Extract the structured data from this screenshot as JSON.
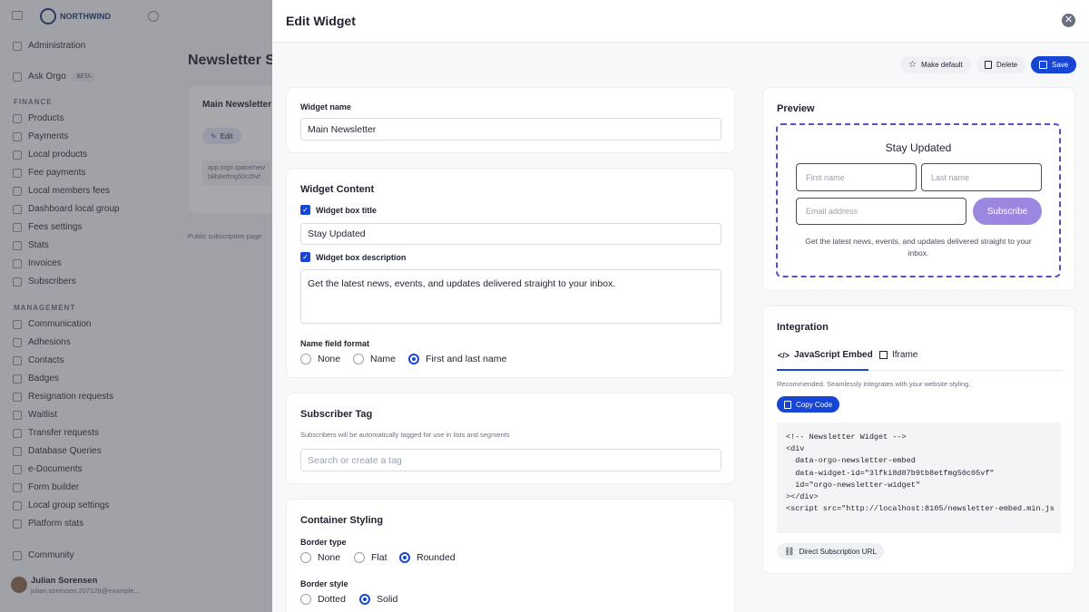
{
  "sidebar": {
    "brand": "NORTHWIND",
    "top_items": [
      "Administration",
      "Ask Orgo"
    ],
    "beta": "BETA",
    "finance_header": "FINANCE",
    "finance_items": [
      "Products",
      "Payments",
      "Local products",
      "Fee payments",
      "Local members fees",
      "Dashboard local group",
      "Fees settings",
      "Stats",
      "Invoices",
      "Subscribers"
    ],
    "management_header": "MANAGEMENT",
    "management_items": [
      "Communication",
      "Adhesions",
      "Contacts",
      "Badges",
      "Resignation requests",
      "Waitlist",
      "Transfer requests",
      "Database Queries",
      "e-Documents",
      "Form builder",
      "Local group settings",
      "Platform stats"
    ],
    "community": "Community",
    "user_name": "Julian Sorensen",
    "user_email": "julian.sorensen.207128@example..."
  },
  "background": {
    "page_title": "Newsletter Su",
    "card_title": "Main Newsletter",
    "edit": "Edit",
    "url_line1": "app.orgo.space/new",
    "url_line2": "b8b8etfmg50c05vf",
    "public_label": "Public subscription page"
  },
  "modal": {
    "title": "Edit Widget",
    "close": "✕",
    "toolbar": {
      "make_default": "Make default",
      "delete": "Delete",
      "save": "Save"
    },
    "widget_name": {
      "label": "Widget name",
      "value": "Main Newsletter"
    },
    "content": {
      "title": "Widget Content",
      "box_title_label": "Widget box title",
      "box_title_value": "Stay Updated",
      "box_desc_label": "Widget box description",
      "box_desc_value": "Get the latest news, events, and updates delivered straight to your inbox.",
      "name_format_label": "Name field format",
      "name_options": [
        "None",
        "Name",
        "First and last name"
      ],
      "name_selected": "First and last name"
    },
    "tag": {
      "title": "Subscriber Tag",
      "help": "Subscribers will be automatically tagged for use in lists and segments",
      "placeholder": "Search or create a tag"
    },
    "styling": {
      "title": "Container Styling",
      "border_type_label": "Border type",
      "border_type_options": [
        "None",
        "Flat",
        "Rounded"
      ],
      "border_type_selected": "Rounded",
      "border_style_label": "Border style",
      "border_style_options": [
        "Dotted",
        "Solid"
      ],
      "border_style_selected": "Solid"
    },
    "preview": {
      "title": "Preview",
      "heading": "Stay Updated",
      "first_name_ph": "First name",
      "last_name_ph": "Last name",
      "email_ph": "Email address",
      "subscribe": "Subscribe",
      "description": "Get the latest news, events, and updates delivered straight to your inbox."
    },
    "integration": {
      "title": "Integration",
      "tab_js": "JavaScript Embed",
      "tab_iframe": "Iframe",
      "recommended": "Recommended. Seamlessly integrates with your website styling.",
      "copy_code": "Copy Code",
      "code": "<!-- Newsletter Widget -->\n<div\n  data-orgo-newsletter-embed\n  data-widget-id=\"3lfki8d87b9tb8etfmg50c05vf\"\n  id=\"orgo-newsletter-widget\"\n></div>\n<script src=\"http://localhost:8105/newsletter-embed.min.js",
      "direct_url": "Direct Subscription URL"
    }
  },
  "colors": {
    "accent": "#1746d4",
    "subscribe": "#9b86e0",
    "preview_border": "#5a4fc8"
  }
}
